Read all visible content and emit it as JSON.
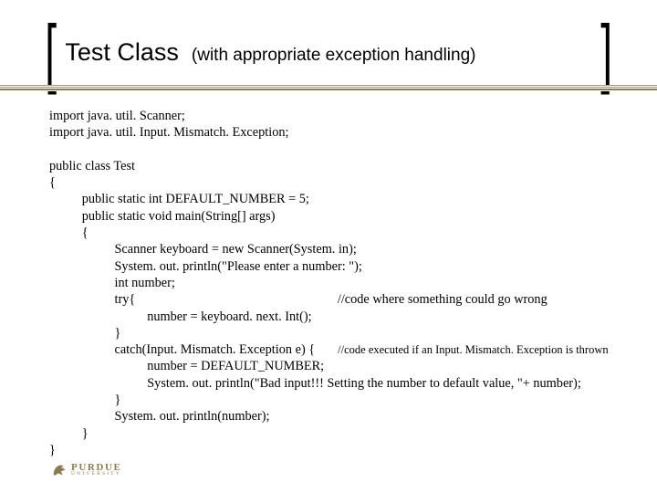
{
  "title": {
    "main": "Test Class",
    "sub": "(with appropriate exception handling)"
  },
  "code": {
    "l01": "import java. util. Scanner;",
    "l02": "import java. util. Input. Mismatch. Exception;",
    "l03": "",
    "l04": "public class Test",
    "l05": "{",
    "l06": "          public static int DEFAULT_NUMBER = 5;",
    "l07": "          public static void main(String[] args)",
    "l08": "          {",
    "l09": "                    Scanner keyboard = new Scanner(System. in);",
    "l10": "                    System. out. println(\"Please enter a number: \");",
    "l11": "                    int number;",
    "l12a": "                    try{                                                              ",
    "l12b": "//code where something could go wrong",
    "l13": "                              number = keyboard. next. Int();",
    "l14": "                    }",
    "l15a": "                    catch(Input. Mismatch. Exception e) {       ",
    "l15b": "//code executed if an Input. Mismatch. Exception is thrown",
    "l16": "                              number = DEFAULT_NUMBER;",
    "l17": "                              System. out. println(\"Bad input!!! Setting the number to default value, \"+ number);",
    "l18": "                    }",
    "l19": "                    System. out. println(number);",
    "l20": "          }",
    "l21": "}"
  },
  "logo": {
    "word": "PURDUE",
    "sub": "UNIVERSITY"
  }
}
